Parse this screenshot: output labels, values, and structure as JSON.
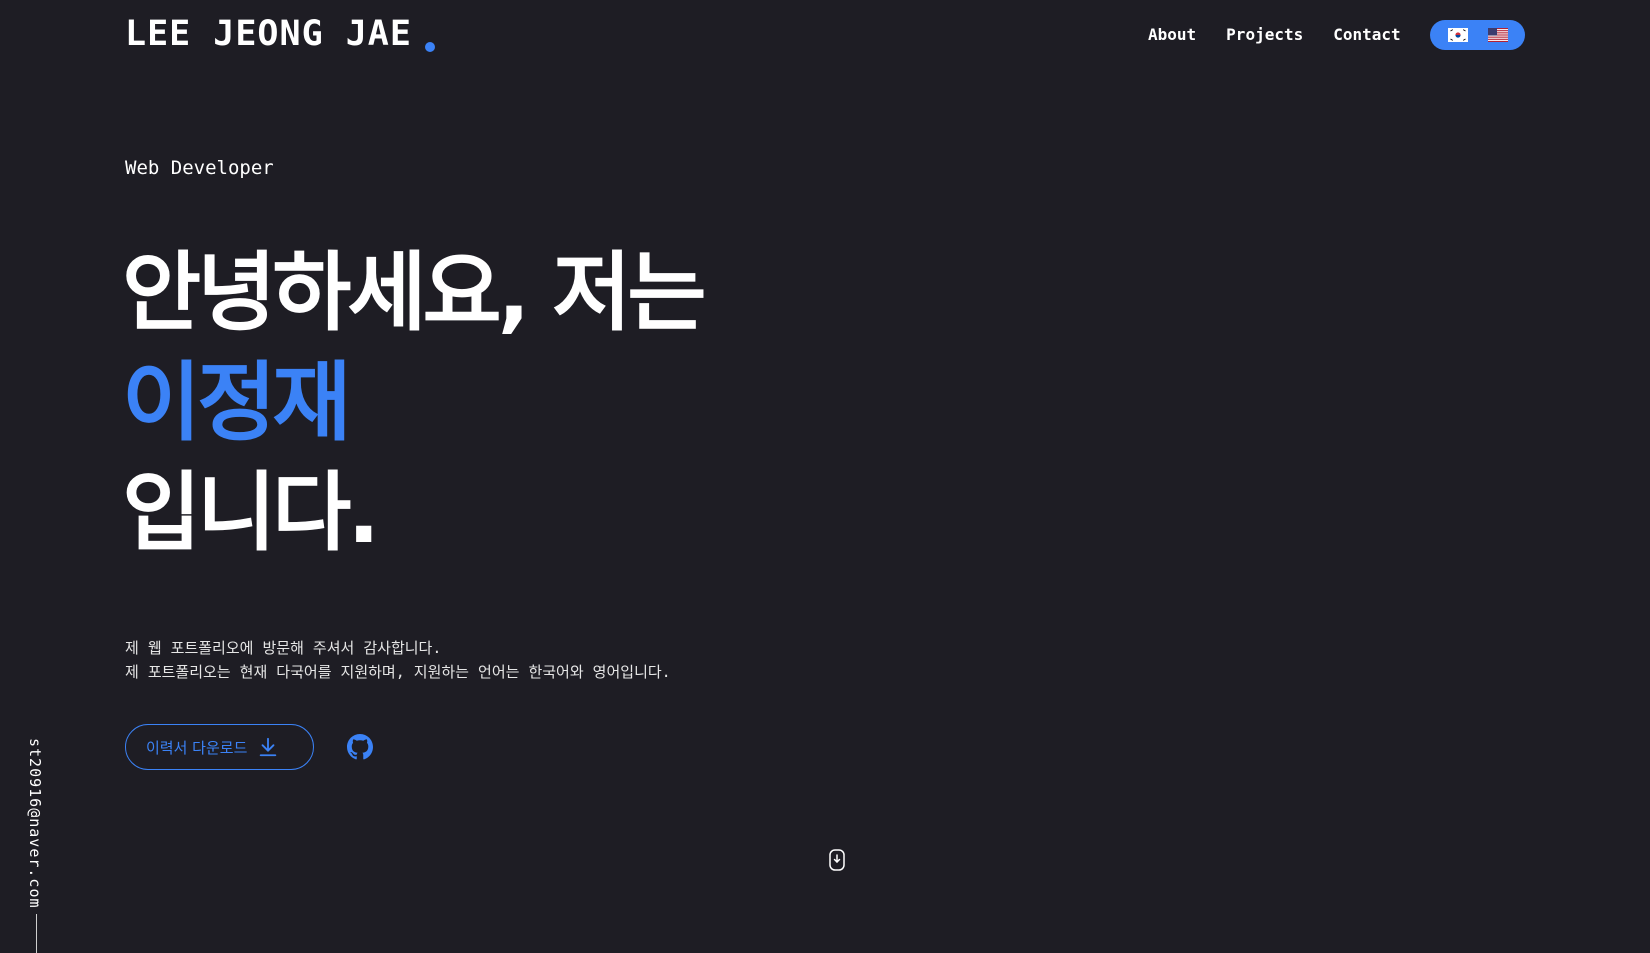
{
  "header": {
    "logo": "LEE JEONG JAE",
    "nav": [
      {
        "label": "About"
      },
      {
        "label": "Projects"
      },
      {
        "label": "Contact"
      }
    ],
    "language_toggle": {
      "options": [
        "korea-flag",
        "us-flag"
      ],
      "color": "#3b82f6"
    }
  },
  "hero": {
    "subtitle": "Web Developer",
    "headline": {
      "line1": "안녕하세요, 저는",
      "name": "이정재",
      "line3": "입니다."
    },
    "description": [
      "제 웹 포트폴리오에 방문해 주셔서 감사합니다.",
      "제 포트폴리오는 현재 다국어를 지원하며, 지원하는 언어는 한국어와 영어입니다."
    ],
    "resume_button": {
      "label": "이력서 다운로드",
      "icon": "download-icon"
    },
    "github": {
      "icon": "github-icon"
    }
  },
  "scroll_indicator": {
    "icon": "mouse-scroll-icon"
  },
  "side": {
    "email": "st20916@naver.com"
  },
  "colors": {
    "background": "#1e1d24",
    "accent": "#3b82f6",
    "text": "#ffffff"
  }
}
